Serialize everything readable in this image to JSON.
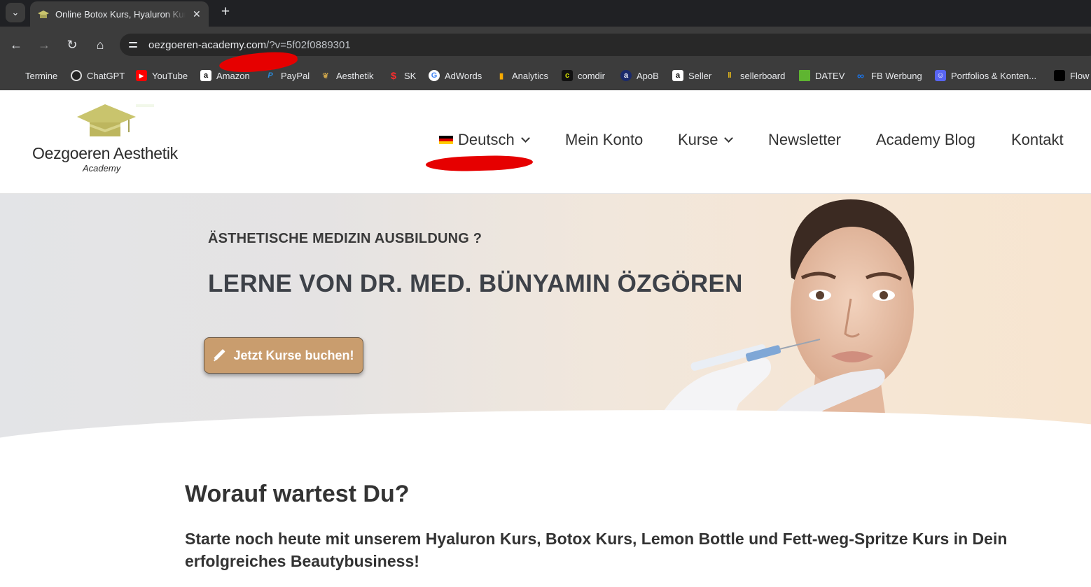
{
  "browser": {
    "tab_title": "Online Botox Kurs, Hyaluron Kurs",
    "url_domain": "oezgoeren-academy.com",
    "url_rest": "/?v=5f02f0889301",
    "bookmarks": [
      {
        "label": "Termine",
        "icon": "none"
      },
      {
        "label": "ChatGPT",
        "icon": "openai-icon"
      },
      {
        "label": "YouTube",
        "icon": "youtube-icon"
      },
      {
        "label": "Amazon",
        "icon": "amazon-icon"
      },
      {
        "label": "PayPal",
        "icon": "paypal-icon"
      },
      {
        "label": "Aesthetik",
        "icon": "lotus-icon"
      },
      {
        "label": "SK",
        "icon": "sparkasse-icon"
      },
      {
        "label": "AdWords",
        "icon": "google-icon"
      },
      {
        "label": "Analytics",
        "icon": "analytics-icon"
      },
      {
        "label": "comdir",
        "icon": "comdir-icon"
      },
      {
        "label": "ApoB",
        "icon": "apob-icon"
      },
      {
        "label": "Seller",
        "icon": "amazon-icon"
      },
      {
        "label": "sellerboard",
        "icon": "sellerboard-icon"
      },
      {
        "label": "DATEV",
        "icon": "datev-icon"
      },
      {
        "label": "FB Werbung",
        "icon": "meta-icon"
      },
      {
        "label": "Portfolios & Konten...",
        "icon": "discord-icon"
      },
      {
        "label": "Flow",
        "icon": "flow-icon"
      }
    ]
  },
  "site": {
    "logo_name": "Oezgoeren Aesthetik",
    "logo_sub": "Academy",
    "nav": {
      "language": "Deutsch",
      "account": "Mein Konto",
      "courses": "Kurse",
      "newsletter": "Newsletter",
      "blog": "Academy Blog",
      "contact": "Kontakt"
    }
  },
  "hero": {
    "kicker": "ÄSTHETISCHE MEDIZIN AUSBILDUNG ?",
    "title": "LERNE VON DR. MED. BÜNYAMIN ÖZGÖREN",
    "cta": "Jetzt Kurse buchen!"
  },
  "intro": {
    "heading": "Worauf wartest Du?",
    "text": "Starte noch heute mit unserem Hyaluron Kurs, Botox Kurs, Lemon Bottle und Fett-weg-Spritze Kurs in Dein erfolgreiches Beautybusiness!"
  },
  "colors": {
    "cta": "#c99d6e",
    "logo_gold": "#c9c46d",
    "redaction": "#e60000"
  }
}
